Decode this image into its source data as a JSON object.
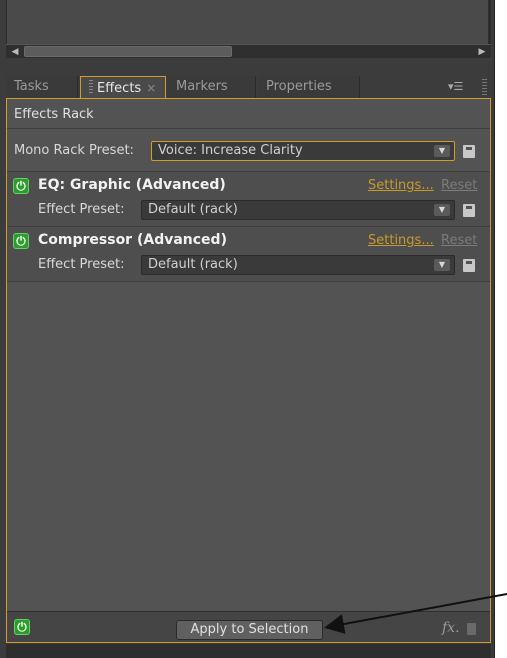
{
  "tabs": [
    {
      "label": "Tasks",
      "active": false
    },
    {
      "label": "Effects",
      "active": true,
      "close": "×"
    },
    {
      "label": "Markers",
      "active": false
    },
    {
      "label": "Properties",
      "active": false
    }
  ],
  "panel": {
    "title": "Effects Rack",
    "preset_label": "Mono Rack Preset:",
    "preset_value": "Voice: Increase Clarity"
  },
  "effects": [
    {
      "name": "EQ: Graphic (Advanced)",
      "settings": "Settings...",
      "reset": "Reset",
      "preset_label": "Effect Preset:",
      "preset_value": "Default (rack)",
      "enabled": true
    },
    {
      "name": "Compressor (Advanced)",
      "settings": "Settings...",
      "reset": "Reset",
      "preset_label": "Effect Preset:",
      "preset_value": "Default (rack)",
      "enabled": true
    }
  ],
  "footer": {
    "apply_label": "Apply to Selection",
    "fx_label": "fx."
  },
  "colors": {
    "accent": "#d39b2c",
    "power_green": "#2f9a2f",
    "panel_bg": "#535353"
  },
  "icons": {
    "power": "power-icon",
    "save": "save-preset-icon",
    "dropdown": "chevron-down-icon",
    "fx": "fx-menu-icon",
    "trash": "trash-icon",
    "panel_menu": "panel-menu-icon"
  }
}
